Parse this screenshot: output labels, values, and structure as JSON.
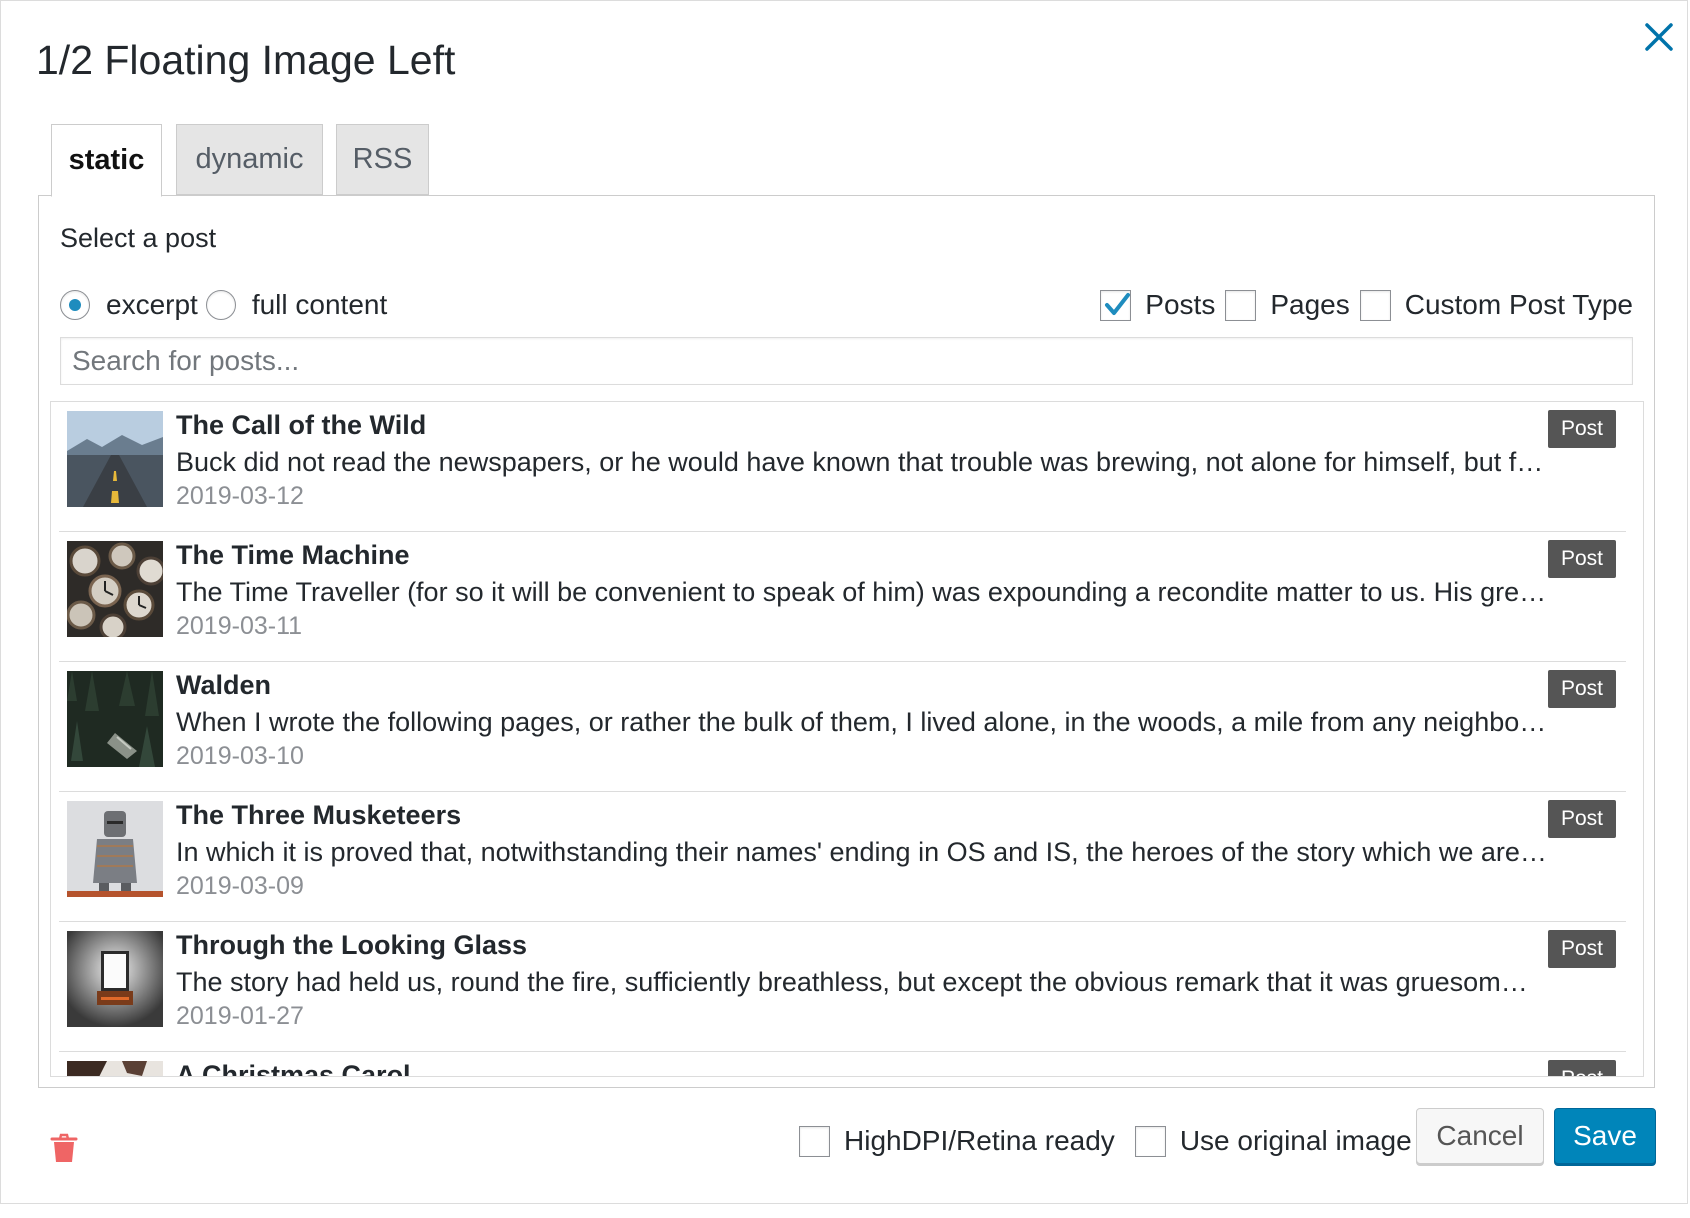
{
  "dialog": {
    "title": "1/2 Floating Image Left"
  },
  "tabs": [
    {
      "label": "static",
      "active": true
    },
    {
      "label": "dynamic",
      "active": false
    },
    {
      "label": "RSS",
      "active": false
    }
  ],
  "panel": {
    "select_label": "Select a post",
    "radios": [
      {
        "label": "excerpt",
        "checked": true
      },
      {
        "label": "full content",
        "checked": false
      }
    ],
    "type_checks": [
      {
        "label": "Posts",
        "checked": true
      },
      {
        "label": "Pages",
        "checked": false
      },
      {
        "label": "Custom Post Type",
        "checked": false
      }
    ],
    "search_placeholder": "Search for posts..."
  },
  "posts": [
    {
      "title": "The Call of the Wild",
      "excerpt": "Buck did not read the newspapers, or he would have known that trouble was brewing, not alone for himself, but f…",
      "date": "2019-03-12",
      "type": "Post"
    },
    {
      "title": "The Time Machine",
      "excerpt": "The Time Traveller (for so it will be convenient to speak of him) was expounding a recondite matter to us. His gre…",
      "date": "2019-03-11",
      "type": "Post"
    },
    {
      "title": "Walden",
      "excerpt": "When I wrote the following pages, or rather the bulk of them, I lived alone, in the woods, a mile from any neighbo…",
      "date": "2019-03-10",
      "type": "Post"
    },
    {
      "title": "The Three Musketeers",
      "excerpt": "In which it is proved that, notwithstanding their names' ending in OS and IS, the heroes of the story which we are…",
      "date": "2019-03-09",
      "type": "Post"
    },
    {
      "title": "Through the Looking Glass",
      "excerpt": "The story had held us, round the fire, sufficiently breathless, but except the obvious remark that it was gruesom…",
      "date": "2019-01-27",
      "type": "Post"
    },
    {
      "title": "A Christmas Carol",
      "excerpt": "",
      "date": "",
      "type": "Post"
    }
  ],
  "footer": {
    "highdpi_label": "HighDPI/Retina ready",
    "original_label": "Use original image",
    "cancel_label": "Cancel",
    "save_label": "Save"
  },
  "colors": {
    "accent": "#0085ba",
    "close": "#0073aa",
    "trash": "#ef6565",
    "badge": "#555555"
  }
}
